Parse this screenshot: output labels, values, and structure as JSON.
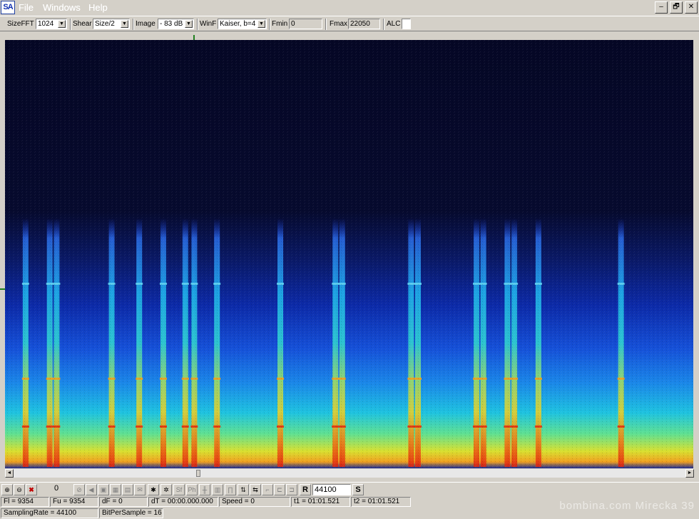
{
  "app": {
    "logo": "SA"
  },
  "menu": [
    "File",
    "Windows",
    "Help"
  ],
  "window_controls": {
    "minimize": "–",
    "restore": "🗗",
    "close": "✕"
  },
  "toolbar": {
    "size_fft": {
      "label": "SizeFFT",
      "value": "1024"
    },
    "shear": {
      "label": "Shear",
      "value": "Size/2"
    },
    "image": {
      "label": "Image",
      "value": "- 83 dB"
    },
    "winf": {
      "label": "WinF",
      "value": "Kaiser, b=4"
    },
    "fmin": {
      "label": "Fmin",
      "value": "0"
    },
    "fmax": {
      "label": "Fmax",
      "value": "22050"
    },
    "alc": {
      "label": "ALC"
    }
  },
  "spectrogram": {
    "colors": {
      "background": "#050725"
    },
    "bursts": [
      0.03,
      0.065,
      0.075,
      0.155,
      0.195,
      0.23,
      0.262,
      0.275,
      0.308,
      0.4,
      0.48,
      0.49,
      0.59,
      0.6,
      0.685,
      0.695,
      0.73,
      0.74,
      0.775,
      0.895
    ]
  },
  "bottom_toolbar": {
    "zoom_value": "0",
    "rate_value": "44100",
    "r_label": "R",
    "s_label": "S",
    "icons": [
      "zoom-in-icon",
      "zoom-out-icon",
      "delete-icon",
      "no-icon",
      "speaker-icon",
      "frame-icon",
      "grid-a-icon",
      "grid-b-icon",
      "envelope-icon",
      "star-icon",
      "star2-icon",
      "sf-icon",
      "ph-icon",
      "bars-icon",
      "comb-icon",
      "wave-icon",
      "arrows-icon",
      "lr-icon",
      "step-icon",
      "step2-icon",
      "step3-icon"
    ]
  },
  "status": {
    "fl": "Fl = 9354",
    "fu": "Fu = 9354",
    "df": "dF = 0",
    "dt": "dT = 00:00.000.000",
    "speed": "Speed = 0",
    "t1": "t1 = 01:01.521",
    "t2": "t2 = 01:01.521",
    "sampling_rate": "SamplingRate = 44100",
    "bits": "BitPerSample = 16"
  },
  "watermark": "bombina.com  Mirecka 39"
}
